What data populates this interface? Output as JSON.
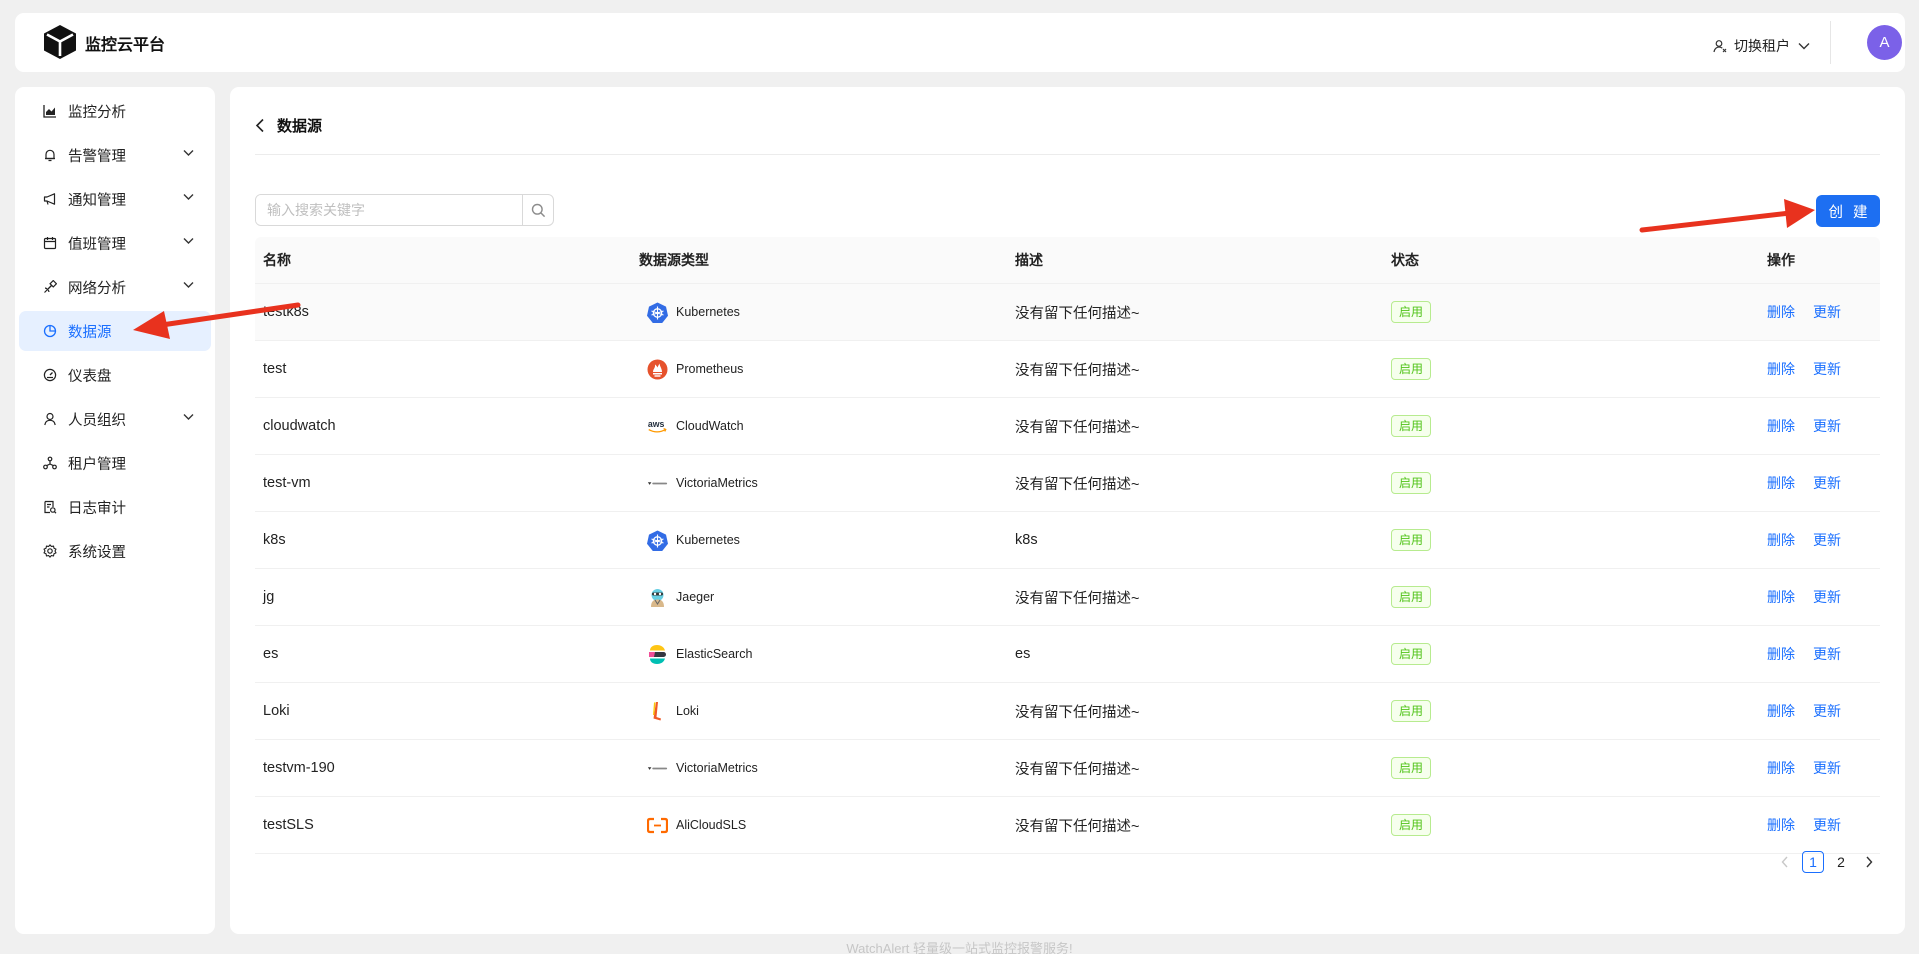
{
  "header": {
    "app_title": "监控云平台",
    "tenant_switch_label": "切换租户",
    "avatar_letter": "A"
  },
  "sidebar": {
    "items": [
      {
        "label": "监控分析",
        "icon": "area-chart-icon",
        "expandable": false,
        "active": false
      },
      {
        "label": "告警管理",
        "icon": "bell-icon",
        "expandable": true,
        "active": false
      },
      {
        "label": "通知管理",
        "icon": "megaphone-icon",
        "expandable": true,
        "active": false
      },
      {
        "label": "值班管理",
        "icon": "calendar-icon",
        "expandable": true,
        "active": false
      },
      {
        "label": "网络分析",
        "icon": "satellite-icon",
        "expandable": true,
        "active": false
      },
      {
        "label": "数据源",
        "icon": "pie-chart-icon",
        "expandable": false,
        "active": true
      },
      {
        "label": "仪表盘",
        "icon": "dashboard-icon",
        "expandable": false,
        "active": false
      },
      {
        "label": "人员组织",
        "icon": "user-icon",
        "expandable": true,
        "active": false
      },
      {
        "label": "租户管理",
        "icon": "cluster-icon",
        "expandable": false,
        "active": false
      },
      {
        "label": "日志审计",
        "icon": "audit-icon",
        "expandable": false,
        "active": false
      },
      {
        "label": "系统设置",
        "icon": "gear-icon",
        "expandable": false,
        "active": false
      }
    ]
  },
  "main": {
    "page_title": "数据源",
    "search_placeholder": "输入搜索关键字",
    "create_label": "创 建",
    "columns": [
      "名称",
      "数据源类型",
      "描述",
      "状态",
      "操作"
    ],
    "rows": [
      {
        "name": "testk8s",
        "type": "Kubernetes",
        "desc": "没有留下任何描述~",
        "status": "启用"
      },
      {
        "name": "test",
        "type": "Prometheus",
        "desc": "没有留下任何描述~",
        "status": "启用"
      },
      {
        "name": "cloudwatch",
        "type": "CloudWatch",
        "desc": "没有留下任何描述~",
        "status": "启用"
      },
      {
        "name": "test-vm",
        "type": "VictoriaMetrics",
        "desc": "没有留下任何描述~",
        "status": "启用"
      },
      {
        "name": "k8s",
        "type": "Kubernetes",
        "desc": "k8s",
        "status": "启用"
      },
      {
        "name": "jg",
        "type": "Jaeger",
        "desc": "没有留下任何描述~",
        "status": "启用"
      },
      {
        "name": "es",
        "type": "ElasticSearch",
        "desc": "es",
        "status": "启用"
      },
      {
        "name": "Loki",
        "type": "Loki",
        "desc": "没有留下任何描述~",
        "status": "启用"
      },
      {
        "name": "testvm-190",
        "type": "VictoriaMetrics",
        "desc": "没有留下任何描述~",
        "status": "启用"
      },
      {
        "name": "testSLS",
        "type": "AliCloudSLS",
        "desc": "没有留下任何描述~",
        "status": "启用"
      }
    ],
    "action_delete": "删除",
    "action_update": "更新",
    "pagination": {
      "pages": [
        "1",
        "2"
      ],
      "current": "1"
    }
  },
  "footer": {
    "text": "WatchAlert 轻量级一站式监控报警服务!"
  },
  "colors": {
    "accent": "#1d6ff2",
    "active_bg": "#e6f0ff",
    "success": "#52c41a",
    "annotation_arrow": "#e8321e"
  }
}
